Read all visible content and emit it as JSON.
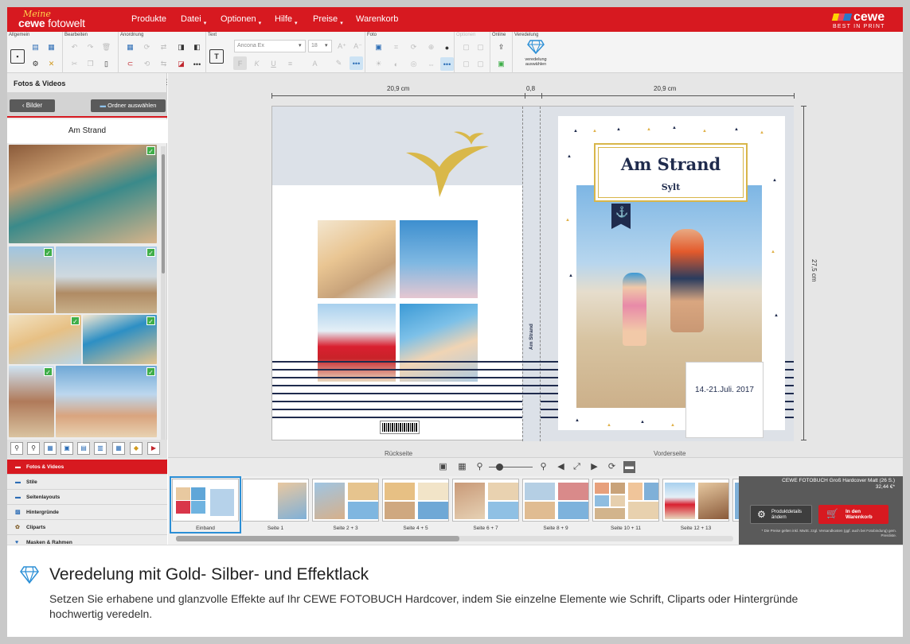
{
  "brand": {
    "meine": "Meine",
    "cewe_bold": "cewe",
    "cewe_rest": " fotowelt",
    "right_logo": "cewe",
    "right_sub": "BEST IN PRINT"
  },
  "menu": [
    "Produkte",
    "Datei",
    "Optionen",
    "Hilfe",
    "Preise",
    "Warenkorb"
  ],
  "toolbar": {
    "groups": [
      "Allgemein",
      "Bearbeiten",
      "Anordnung",
      "Text",
      "Foto",
      "Optionen",
      "Online",
      "Veredelung"
    ],
    "font": "Ancona Ex",
    "size": "18",
    "veredelung_label": "veredelung auswählen"
  },
  "left_panel": {
    "title": "Fotos & Videos",
    "back_label": "Bilder",
    "folder_label": "Ordner auswählen",
    "album": "Am Strand",
    "nav": [
      {
        "label": "Fotos & Videos",
        "icon": "photos-icon",
        "active": true
      },
      {
        "label": "Stile",
        "icon": "styles-icon",
        "active": false
      },
      {
        "label": "Seitenlayouts",
        "icon": "layouts-icon",
        "active": false
      },
      {
        "label": "Hintergründe",
        "icon": "backgrounds-icon",
        "active": false
      },
      {
        "label": "Cliparts",
        "icon": "cliparts-icon",
        "active": false
      },
      {
        "label": "Masken & Rahmen",
        "icon": "masks-icon",
        "active": false
      }
    ]
  },
  "workspace": {
    "dim_left": "20,9 cm",
    "dim_spine": "0,8",
    "dim_right": "20,9 cm",
    "dim_height": "27,5 cm",
    "title": "Am Strand",
    "subtitle": "Sylt",
    "date": "14.-21.Juli. 2017",
    "spine_text": "Am Strand",
    "back_label": "Rückseite",
    "front_label": "Vorderseite"
  },
  "pages": [
    "Einband",
    "Seite 1",
    "Seite 2 + 3",
    "Seite 4 + 5",
    "Seite 6 + 7",
    "Seite 8 + 9",
    "Seite 10 + 11",
    "Seite 12 + 13"
  ],
  "order": {
    "product": "CEWE FOTOBUCH Groß Hardcover Matt (26 S.)",
    "price": "32,44 €*",
    "details_label": "Produktdetails ändern",
    "cart_label": "In den Warenkorb",
    "note": "* Die Preise gelten inkl. MwSt. zzgl. Versandkosten (ggf. auch bei Fotobindung) gem. Preisliste."
  },
  "caption": {
    "title": "Veredelung mit Gold- Silber- und Effektlack",
    "body": "Setzen Sie erhabene und glanzvolle Effekte auf Ihr CEWE FOTOBUCH Hardcover, indem Sie einzelne Elemente wie Schrift, Cliparts oder Hintergründe hochwertig veredeln."
  },
  "colors": {
    "brand_red": "#d71920",
    "navy": "#1f2b4d",
    "gold": "#d8b64a",
    "check_green": "#3fae49"
  }
}
